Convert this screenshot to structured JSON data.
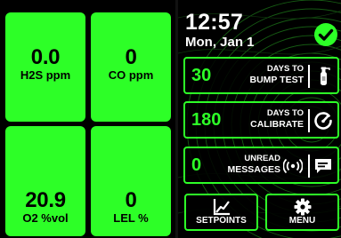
{
  "sensors": [
    {
      "value": "0.0",
      "label": "H2S ppm"
    },
    {
      "value": "0",
      "label": "CO ppm"
    },
    {
      "value": "20.9",
      "label": "O2 %vol"
    },
    {
      "value": "0",
      "label": "LEL %"
    }
  ],
  "status": {
    "time": "12:57",
    "date": "Mon, Jan 1",
    "ok_icon": "check-circle-icon"
  },
  "cards": [
    {
      "value": "30",
      "line1": "DAYS TO",
      "line2": "BUMP TEST",
      "icon": "gas-bottle-icon"
    },
    {
      "value": "180",
      "line1": "DAYS TO",
      "line2": "CALIBRATE",
      "icon": "gauge-icon"
    },
    {
      "value": "0",
      "line1": "UNREAD",
      "line2": "MESSAGES",
      "icon": "message-icon",
      "icon2": "signal-radar-icon"
    }
  ],
  "buttons": [
    {
      "label": "SETPOINTS",
      "icon": "chart-line-icon"
    },
    {
      "label": "MENU",
      "icon": "gear-icon"
    }
  ],
  "colors": {
    "accent": "#2dff27",
    "background": "#000000",
    "text": "#ffffff"
  }
}
